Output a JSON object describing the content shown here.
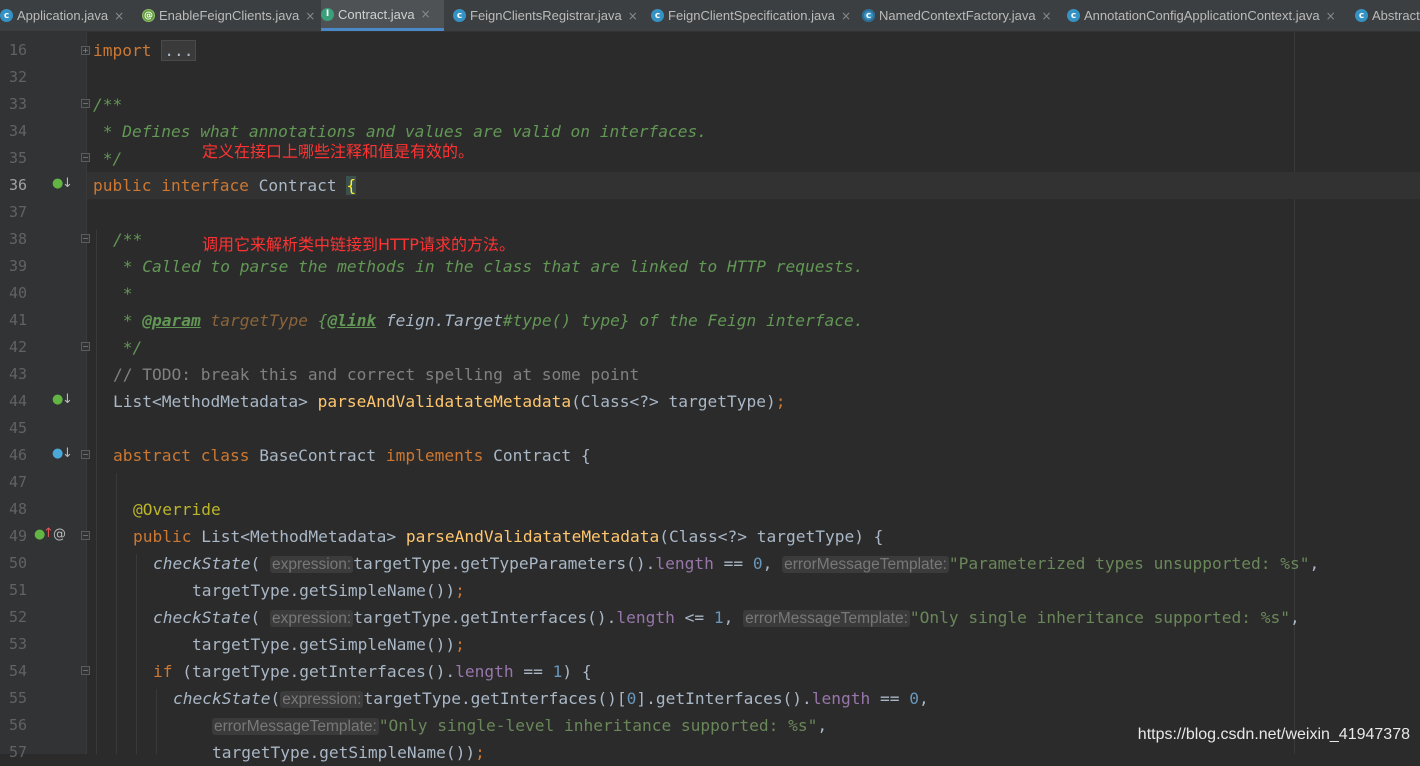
{
  "tabs": [
    {
      "label": "Application.java",
      "icon": "spring-class-icon",
      "active": false
    },
    {
      "label": "EnableFeignClients.java",
      "icon": "annotation-icon",
      "active": false
    },
    {
      "label": "Contract.java",
      "icon": "interface-icon",
      "active": true
    },
    {
      "label": "FeignClientsRegistrar.java",
      "icon": "class-icon",
      "active": false
    },
    {
      "label": "FeignClientSpecification.java",
      "icon": "class-icon",
      "active": false
    },
    {
      "label": "NamedContextFactory.java",
      "icon": "abstract-class-icon",
      "active": false
    },
    {
      "label": "AnnotationConfigApplicationContext.java",
      "icon": "class-icon",
      "active": false
    },
    {
      "label": "Abstract",
      "icon": "class-icon",
      "active": false
    }
  ],
  "tab_close_glyph": "×",
  "line_numbers": [
    "16",
    "32",
    "33",
    "34",
    "35",
    "36",
    "37",
    "38",
    "39",
    "40",
    "41",
    "42",
    "43",
    "44",
    "45",
    "46",
    "47",
    "48",
    "49",
    "50",
    "51",
    "52",
    "53",
    "54",
    "55",
    "56",
    "57"
  ],
  "current_line": "36",
  "folded_import": "...",
  "notes": {
    "note1": "定义在接口上哪些注释和值是有效的。",
    "note2": "调用它来解析类中链接到HTTP请求的方法。"
  },
  "hints": {
    "expression": "expression:",
    "errorMessageTemplate": "errorMessageTemplate:"
  },
  "watermark": "https://blog.csdn.net/weixin_41947378",
  "colors": {
    "background": "#2b2b2b",
    "gutter": "#313335",
    "keyword": "#cc7832",
    "method": "#ffc66d",
    "string": "#6a8759",
    "number": "#6897bb",
    "doc": "#629755",
    "annotation_red_note": "#ff3333",
    "active_tab_underline": "#4a88c7"
  }
}
